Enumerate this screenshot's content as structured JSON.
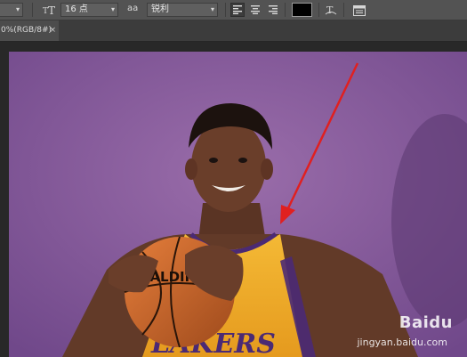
{
  "options_bar": {
    "font_size_value": "16 点",
    "antialias_label": "aa",
    "antialias_value": "锐利",
    "text_orientation_icon": "text-orientation-icon",
    "align_icons": [
      "align-left-icon",
      "align-center-icon",
      "align-right-icon"
    ],
    "color_swatch": "#000000"
  },
  "document_tab": {
    "title": "0%(RGB/8#)",
    "close": "×"
  },
  "canvas": {
    "background": "#8a5e9a",
    "jersey_text": "LAKERS",
    "ball_brand": "SPALDING"
  },
  "watermark": {
    "brand": "Baidu",
    "url": "jingyan.baidu.com"
  },
  "annotation_color": "#e02020"
}
